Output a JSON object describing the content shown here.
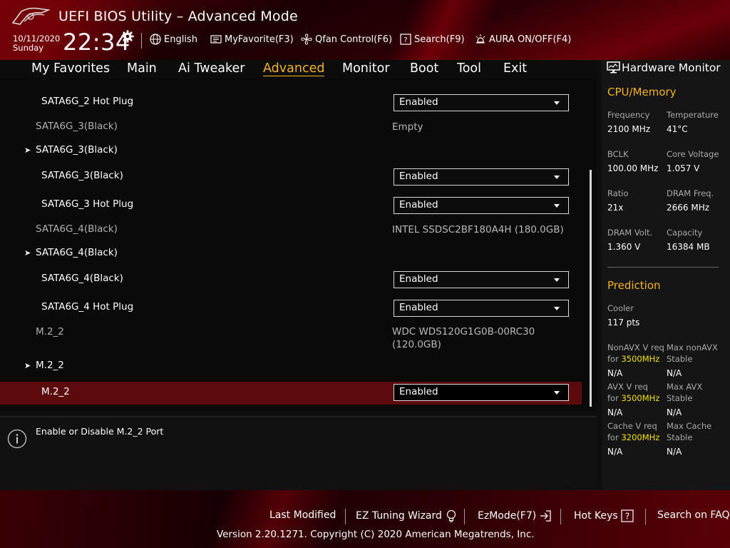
{
  "header": {
    "title": "UEFI BIOS Utility – Advanced Mode",
    "date": "10/11/2020",
    "day": "Sunday",
    "time": "22:34",
    "tools": {
      "language": "English",
      "favorite": "MyFavorite(F3)",
      "qfan": "Qfan Control(F6)",
      "search": "Search(F9)",
      "aura": "AURA ON/OFF(F4)"
    }
  },
  "tabs": {
    "favorites": "My Favorites",
    "main": "Main",
    "tweaker": "Ai Tweaker",
    "advanced": "Advanced",
    "monitor": "Monitor",
    "boot": "Boot",
    "tool": "Tool",
    "exit": "Exit",
    "active": "Advanced"
  },
  "settings": {
    "r1": {
      "label": "SATA6G_2 Hot Plug",
      "value": "Enabled"
    },
    "r2": {
      "label": "SATA6G_3(Black)",
      "value": "Empty"
    },
    "r3": {
      "label": "SATA6G_3(Black)"
    },
    "r4": {
      "label": "SATA6G_3(Black)",
      "value": "Enabled"
    },
    "r5": {
      "label": "SATA6G_3 Hot Plug",
      "value": "Enabled"
    },
    "r6": {
      "label": "SATA6G_4(Black)",
      "value": "INTEL SSDSC2BF180A4H (180.0GB)"
    },
    "r7": {
      "label": "SATA6G_4(Black)"
    },
    "r8": {
      "label": "SATA6G_4(Black)",
      "value": "Enabled"
    },
    "r9": {
      "label": "SATA6G_4 Hot Plug",
      "value": "Enabled"
    },
    "r10": {
      "label": "M.2_2",
      "value_line1": "WDC WDS120G1G0B-00RC30",
      "value_line2": "(120.0GB)"
    },
    "r11": {
      "label": "M.2_2"
    },
    "r12": {
      "label": "M.2_2",
      "value": "Enabled"
    }
  },
  "help": {
    "text": "Enable or Disable M.2_2 Port"
  },
  "hardware_monitor": {
    "title": "Hardware Monitor",
    "cpu_section": "CPU/Memory",
    "frequency_label": "Frequency",
    "frequency": "2100 MHz",
    "temperature_label": "Temperature",
    "temperature": "41°C",
    "bclk_label": "BCLK",
    "bclk": "100.00 MHz",
    "core_voltage_label": "Core Voltage",
    "core_voltage": "1.057 V",
    "ratio_label": "Ratio",
    "ratio": "21x",
    "dram_freq_label": "DRAM Freq.",
    "dram_freq": "2666 MHz",
    "dram_volt_label": "DRAM Volt.",
    "dram_volt": "1.360 V",
    "capacity_label": "Capacity",
    "capacity": "16384 MB",
    "prediction_section": "Prediction",
    "cooler_label": "Cooler",
    "cooler": "117 pts",
    "nonavx_v_req_label": "NonAVX V req",
    "for_label": "for",
    "nonavx_freq": "3500MHz",
    "nonavx_v_req": "N/A",
    "max_nonavx_label_1": "Max nonAVX",
    "stable_label": "Stable",
    "max_nonavx": "N/A",
    "avx_v_req_label": "AVX V req",
    "avx_freq": "3500MHz",
    "avx_v_req": "N/A",
    "max_avx_label": "Max AVX",
    "max_avx": "N/A",
    "cache_v_req_label": "Cache V req",
    "cache_freq": "3200MHz",
    "cache_v_req": "N/A",
    "max_cache_label": "Max Cache",
    "max_cache": "N/A"
  },
  "footer": {
    "last_modified": "Last Modified",
    "ez_tuning": "EZ Tuning Wizard",
    "ezmode": "EzMode(F7)",
    "hot_keys": "Hot Keys",
    "hot_keys_glyph": "?",
    "search_faq": "Search on FAQ",
    "copyright": "Version 2.20.1271. Copyright (C) 2020 American Megatrends, Inc."
  },
  "colors": {
    "accent": "#f5b51f",
    "selected_row": "#5c0a0e",
    "prediction_freq": "#f5e100"
  }
}
